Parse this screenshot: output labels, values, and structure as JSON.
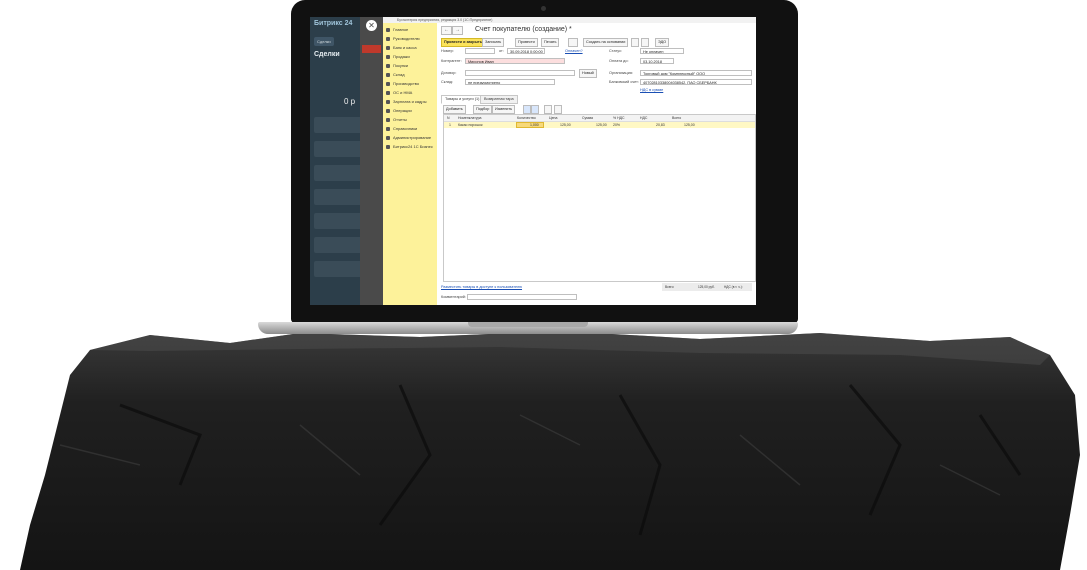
{
  "bitrix": {
    "logo": "Битрикс 24",
    "tab_label": "Сделки",
    "title": "Сделки",
    "amount": "0 р"
  },
  "onec": {
    "close_glyph": "✕",
    "window_title": "Бухгалтерия предприятия, редакция 3.0 (1С:Предприятие)",
    "menu": [
      "Главное",
      "Руководителю",
      "Банк и касса",
      "Продажи",
      "Покупки",
      "Склад",
      "Производство",
      "ОС и НМА",
      "Зарплата и кадры",
      "Операции",
      "Отчеты",
      "Справочники",
      "Администрирование",
      "Битрикс24 1С Бизнес"
    ],
    "nav_back": "←",
    "nav_forward": "→",
    "doc_title": "Счет покупателю (создание) *",
    "toolbar": {
      "post_close": "Провести и закрыть",
      "save": "Записать",
      "post": "Провести",
      "print": "Печать",
      "create_based": "Создать на основании",
      "edo": "ЭДО"
    },
    "fields": {
      "number_label": "Номер:",
      "date_from_label": "от:",
      "date_value": "30.09.2018  0:00:00",
      "paid_link": "Оплачен?",
      "counterparty_label": "Контрагент:",
      "counterparty_value": "Миронов Иван",
      "contract_label": "Договор:",
      "new_button": "Новый",
      "warehouse_label": "Склад:",
      "warehouse_value": "не предусмотрено",
      "status_label": "Статус:",
      "status_value": "Не оплачен",
      "pay_until_label": "Оплата до:",
      "pay_until_value": "03.10.2018",
      "organization_label": "Организация:",
      "organization_value": "Торговый дом \"Комплексный\" ООО",
      "bank_label": "Банковский счет:",
      "bank_value": "40702810338004038542, ПАО СБЕРБАНК",
      "vat_link": "НДС в сумме"
    },
    "tabs": [
      "Товары и услуги (1)",
      "Возвратная тара"
    ],
    "grid_buttons": {
      "add": "Добавить",
      "select": "Подбор",
      "change": "Изменить"
    },
    "columns": [
      "N",
      "Номенклатура",
      "Количество",
      "Цена",
      "Сумма",
      "% НДС",
      "НДС",
      "Всего"
    ],
    "rows": [
      {
        "n": "1",
        "item": "Какао порошок",
        "qty": "1,000",
        "price": "125,00",
        "sum": "125,00",
        "vat_rate": "20%",
        "vat": "20,83",
        "total": "125,00"
      }
    ],
    "footer": {
      "reserve_link": "Разместить товары в доступе к пользователю",
      "comment_label": "Комментарий:",
      "total_label": "Всего:",
      "total_value": "125,00 руб.",
      "vat_total": "НДС (в т. ч.):"
    }
  },
  "colors": {
    "menu_bg": "#fdf29a",
    "primary_btn": "#fbe35a",
    "row_highlight": "#fff8c4",
    "required_field": "#fcdede",
    "bitrix_bg": "#2c3e4a",
    "rock": "#1c1c1c"
  }
}
